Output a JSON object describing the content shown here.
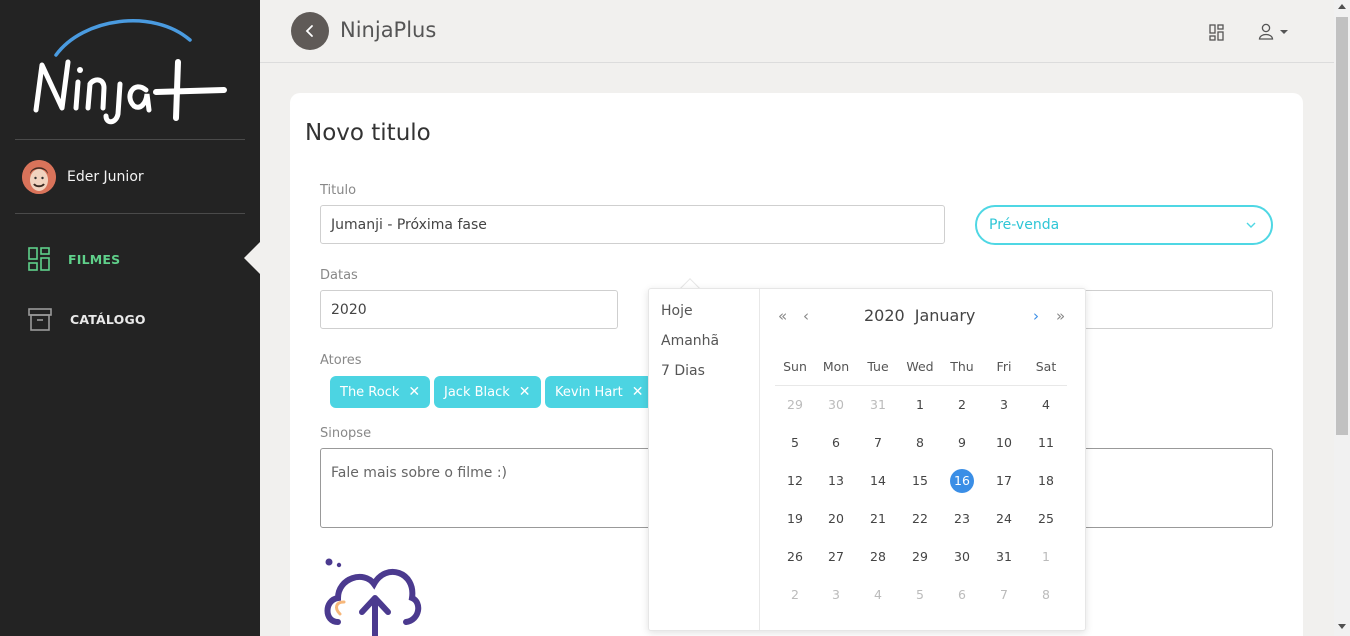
{
  "sidebar": {
    "logo_text": "Ninja+",
    "user_name": "Eder Junior",
    "nav": [
      {
        "label": "FILMES",
        "icon": "grid-icon",
        "active": true
      },
      {
        "label": "CATÁLOGO",
        "icon": "archive-icon",
        "active": false
      }
    ]
  },
  "topbar": {
    "title": "NinjaPlus",
    "back_icon": "chevron-left-icon",
    "right_icons": [
      "grid-icon",
      "user-icon",
      "caret-down-icon"
    ]
  },
  "form": {
    "heading": "Novo titulo",
    "titulo_label": "Titulo",
    "titulo_value": "Jumanji - Próxima fase",
    "status_value": "Pré-venda",
    "datas_label": "Datas",
    "datas_value": "2020",
    "atores_label": "Atores",
    "actors": [
      "The Rock",
      "Jack Black",
      "Kevin Hart"
    ],
    "tag_remove": "✕",
    "sinopse_label": "Sinopse",
    "sinopse_placeholder": "Fale mais sobre o filme :)"
  },
  "datepicker": {
    "presets": [
      "Hoje",
      "Amanhã",
      "7 Dias"
    ],
    "year": "2020",
    "month": "January",
    "weekdays": [
      "Sun",
      "Mon",
      "Tue",
      "Wed",
      "Thu",
      "Fri",
      "Sat"
    ],
    "weeks": [
      [
        "29",
        "30",
        "31",
        "1",
        "2",
        "3",
        "4"
      ],
      [
        "5",
        "6",
        "7",
        "8",
        "9",
        "10",
        "11"
      ],
      [
        "12",
        "13",
        "14",
        "15",
        "16",
        "17",
        "18"
      ],
      [
        "19",
        "20",
        "21",
        "22",
        "23",
        "24",
        "25"
      ],
      [
        "26",
        "27",
        "28",
        "29",
        "30",
        "31",
        "1"
      ],
      [
        "2",
        "3",
        "4",
        "5",
        "6",
        "7",
        "8"
      ]
    ],
    "selected_day": "16",
    "accent_color": "#3a8ee6"
  },
  "colors": {
    "sidebar_bg": "#232323",
    "active_nav": "#5fd08a",
    "tag_bg": "#4cd4e2",
    "select_border": "#4fd7e4"
  }
}
